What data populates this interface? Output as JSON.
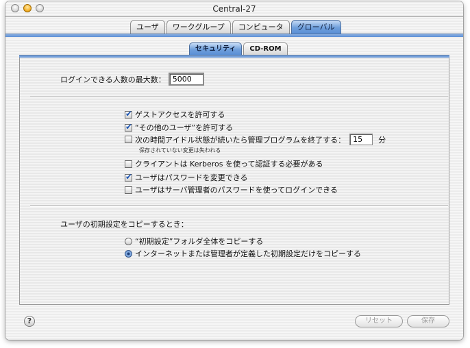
{
  "window": {
    "title": "Central-27"
  },
  "tabs": [
    {
      "label": "ユーザ",
      "selected": false
    },
    {
      "label": "ワークグループ",
      "selected": false
    },
    {
      "label": "コンピュータ",
      "selected": false
    },
    {
      "label": "グローバル",
      "selected": true
    }
  ],
  "subtabs": [
    {
      "label": "セキュリティ",
      "selected": true
    },
    {
      "label": "CD-ROM",
      "selected": false
    }
  ],
  "max_login": {
    "label": "ログインできる人数の最大数：",
    "value": "5000"
  },
  "options": [
    {
      "label": "ゲストアクセスを許可する",
      "checked": true
    },
    {
      "label": "“その他のユーザ”を許可する",
      "checked": true
    },
    {
      "label": "次の時間アイドル状態が続いたら管理プログラムを終了する：",
      "checked": false,
      "value": "15",
      "unit": "分",
      "note": "保存されていない変更は失われる"
    },
    {
      "label": "クライアントは Kerberos を使って認証する必要がある",
      "checked": false
    },
    {
      "label": "ユーザはパスワードを変更できる",
      "checked": true
    },
    {
      "label": "ユーザはサーバ管理者のパスワードを使ってログインできる",
      "checked": false
    }
  ],
  "copy_prefs": {
    "label": "ユーザの初期設定をコピーするとき：",
    "choices": [
      {
        "label": "“初期設定”フォルダ全体をコピーする",
        "selected": false
      },
      {
        "label": "インターネットまたは管理者が定義した初期設定だけをコピーする",
        "selected": true
      }
    ]
  },
  "footer": {
    "help": "?",
    "reset": "リセット",
    "save": "保存"
  }
}
